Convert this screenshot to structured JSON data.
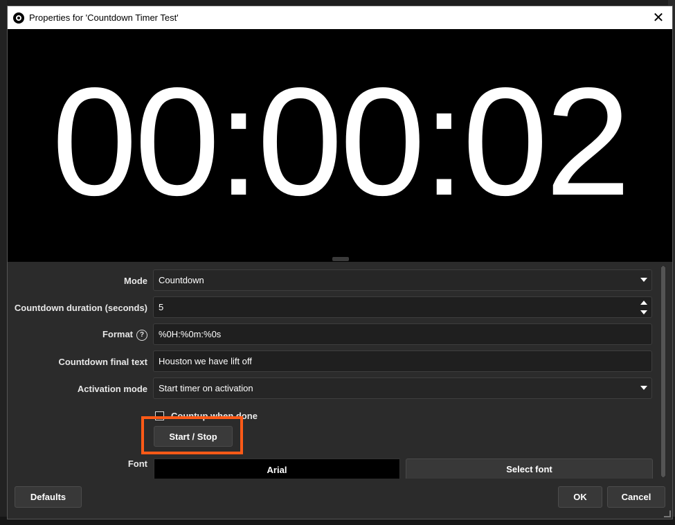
{
  "dialog": {
    "title": "Properties for 'Countdown Timer Test'",
    "close_glyph": "✕"
  },
  "preview": {
    "timer_text": "00:00:02"
  },
  "properties": {
    "mode": {
      "label": "Mode",
      "value": "Countdown"
    },
    "duration": {
      "label": "Countdown duration (seconds)",
      "value": "5"
    },
    "format": {
      "label": "Format",
      "help_glyph": "?",
      "value": "%0H:%0m:%0s"
    },
    "final_text": {
      "label": "Countdown final text",
      "value": "Houston we have lift  off"
    },
    "activation_mode": {
      "label": "Activation mode",
      "value": "Start timer on activation"
    },
    "countup": {
      "label": "Countup when done",
      "checked": false
    },
    "start_stop_label": "Start / Stop",
    "font": {
      "label": "Font",
      "value": "Arial",
      "select_label": "Select font"
    }
  },
  "buttons": {
    "defaults": "Defaults",
    "ok": "OK",
    "cancel": "Cancel"
  },
  "colors": {
    "highlight": "#ff5a17",
    "background": "#2b2b2b",
    "preview": "#000000"
  }
}
